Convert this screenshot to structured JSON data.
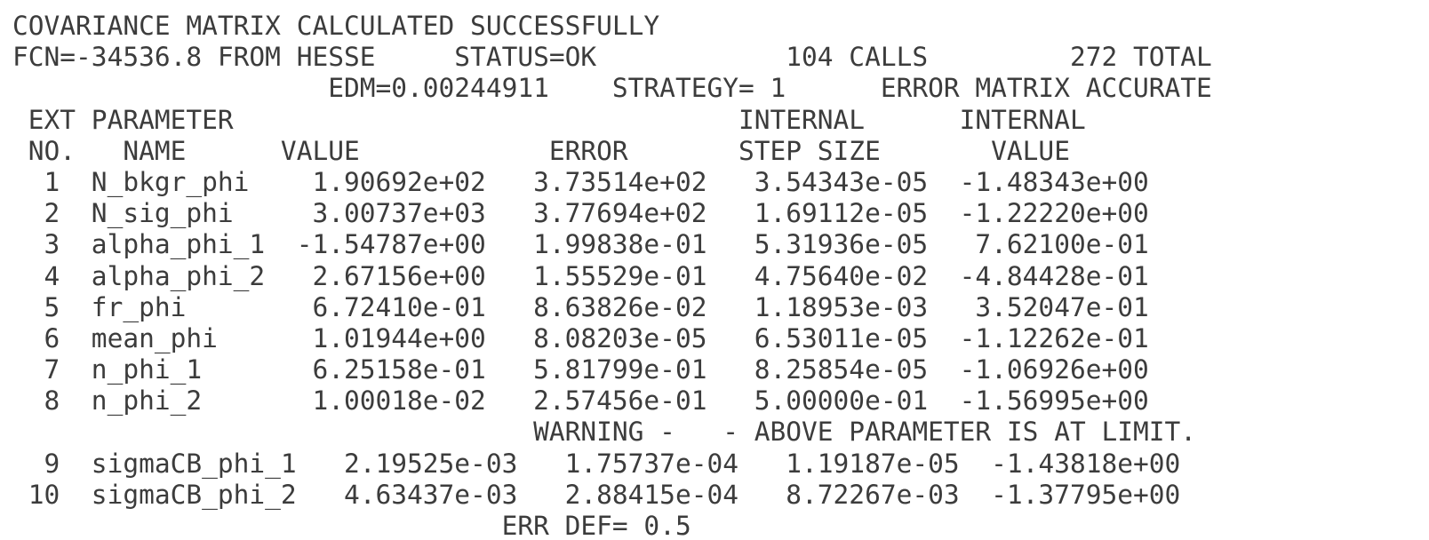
{
  "terminal": {
    "lines": [
      "COVARIANCE MATRIX CALCULATED SUCCESSFULLY",
      "FCN=-34536.8 FROM HESSE     STATUS=OK            104 CALLS         272 TOTAL",
      "                    EDM=0.00244911    STRATEGY= 1      ERROR MATRIX ACCURATE",
      " EXT PARAMETER                                INTERNAL      INTERNAL",
      " NO.   NAME      VALUE            ERROR       STEP SIZE       VALUE",
      "  1  N_bkgr_phi    1.90692e+02   3.73514e+02   3.54343e-05  -1.48343e+00",
      "  2  N_sig_phi     3.00737e+03   3.77694e+02   1.69112e-05  -1.22220e+00",
      "  3  alpha_phi_1  -1.54787e+00   1.99838e-01   5.31936e-05   7.62100e-01",
      "  4  alpha_phi_2   2.67156e+00   1.55529e-01   4.75640e-02  -4.84428e-01",
      "  5  fr_phi        6.72410e-01   8.63826e-02   1.18953e-03   3.52047e-01",
      "  6  mean_phi      1.01944e+00   8.08203e-05   6.53011e-05  -1.12262e-01",
      "  7  n_phi_1       6.25158e-01   5.81799e-01   8.25854e-05  -1.06926e+00",
      "  8  n_phi_2       1.00018e-02   2.57456e-01   5.00000e-01  -1.56995e+00",
      "                                 WARNING -   - ABOVE PARAMETER IS AT LIMIT.",
      "  9  sigmaCB_phi_1   2.19525e-03   1.75737e-04   1.19187e-05  -1.43818e+00",
      " 10  sigmaCB_phi_2   4.63437e-03   2.88415e-04   8.72267e-03  -1.37795e+00",
      "                               ERR DEF= 0.5"
    ]
  }
}
